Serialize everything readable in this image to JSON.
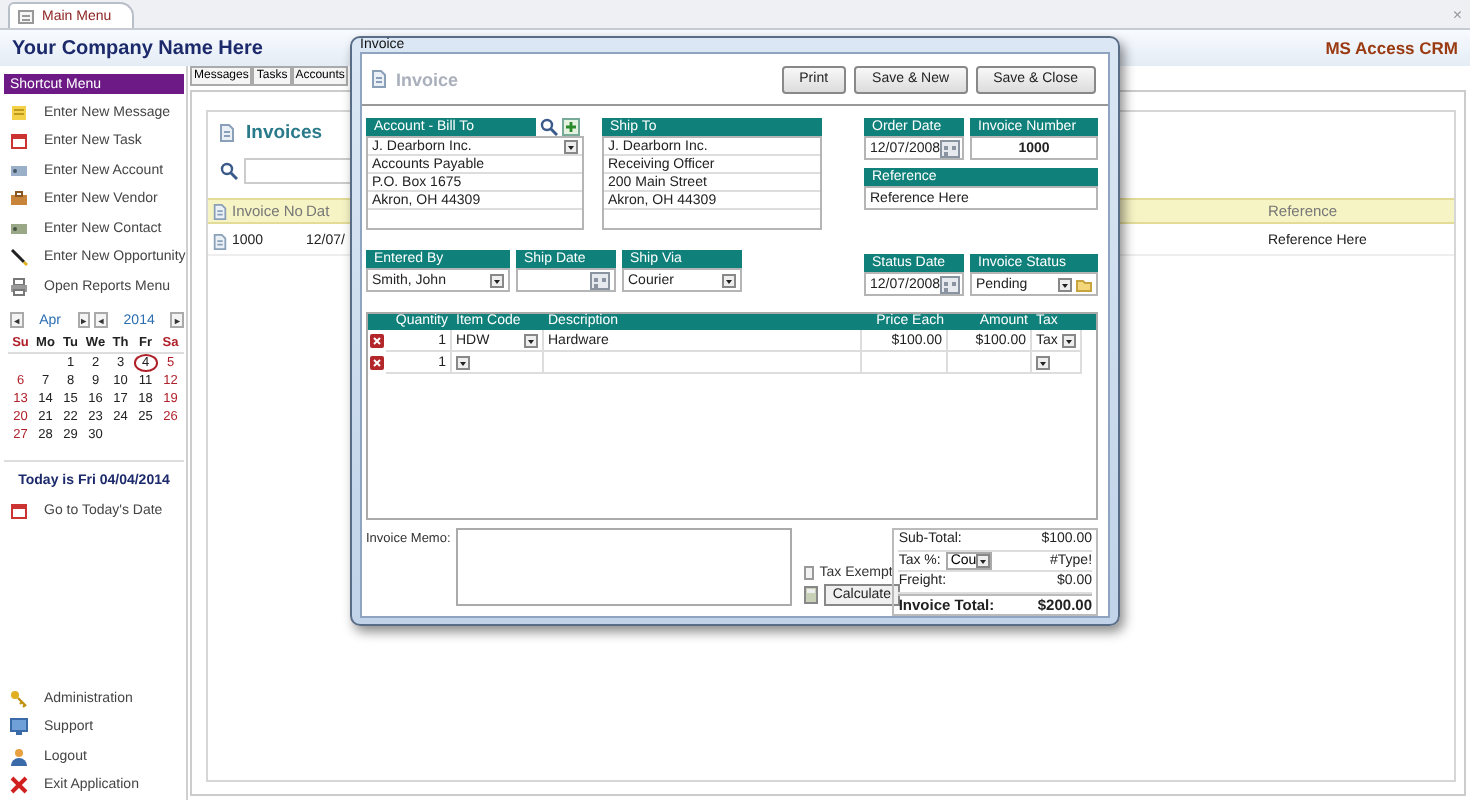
{
  "app_tab": {
    "label": "Main Menu",
    "close": "×"
  },
  "header": {
    "company": "Your Company Name Here",
    "product": "MS Access CRM"
  },
  "sidebar": {
    "title": "Shortcut Menu",
    "items": [
      {
        "label": "Enter New Message"
      },
      {
        "label": "Enter New Task"
      },
      {
        "label": "Enter New Account"
      },
      {
        "label": "Enter New Vendor"
      },
      {
        "label": "Enter New Contact"
      },
      {
        "label": "Enter New Opportunity"
      },
      {
        "label": "Open Reports Menu"
      }
    ],
    "calendar": {
      "month_prev": "◄",
      "month": "Apr",
      "month_next": "►",
      "year_prev": "◄",
      "year": "2014",
      "year_next": "►",
      "weekdays": [
        "Su",
        "Mo",
        "Tu",
        "We",
        "Th",
        "Fr",
        "Sa"
      ],
      "weeks": [
        [
          {
            "day": "1",
            "selected": false
          },
          {
            "day": "2",
            "selected": false
          },
          {
            "day": "3",
            "selected": false
          },
          {
            "day": "4",
            "selected": true
          },
          {
            "day": "5",
            "selected": false
          }
        ],
        [
          {
            "day": "6",
            "selected": false
          },
          {
            "day": "7",
            "selected": false
          },
          {
            "day": "8",
            "selected": false
          },
          {
            "day": "9",
            "selected": false
          },
          {
            "day": "10",
            "selected": false
          },
          {
            "day": "11",
            "selected": false
          },
          {
            "day": "12",
            "selected": false
          }
        ],
        [
          {
            "day": "13",
            "selected": false
          },
          {
            "day": "14",
            "selected": false
          },
          {
            "day": "15",
            "selected": false
          },
          {
            "day": "16",
            "selected": false
          },
          {
            "day": "17",
            "selected": false
          },
          {
            "day": "18",
            "selected": false
          },
          {
            "day": "19",
            "selected": false
          }
        ],
        [
          {
            "day": "20",
            "selected": false
          },
          {
            "day": "21",
            "selected": false
          },
          {
            "day": "22",
            "selected": false
          },
          {
            "day": "23",
            "selected": false
          },
          {
            "day": "24",
            "selected": false
          },
          {
            "day": "25",
            "selected": false
          },
          {
            "day": "26",
            "selected": false
          }
        ],
        [
          {
            "day": "27",
            "selected": false
          },
          {
            "day": "28",
            "selected": false
          },
          {
            "day": "29",
            "selected": false
          },
          {
            "day": "30",
            "selected": false
          }
        ]
      ]
    },
    "today": "Today is Fri 04/04/2014",
    "goto": "Go to Today's Date",
    "footer_items": [
      {
        "label": "Administration"
      },
      {
        "label": "Support"
      },
      {
        "label": "Logout"
      },
      {
        "label": "Exit Application"
      }
    ]
  },
  "tabs": [
    {
      "label": "Messages"
    },
    {
      "label": "Tasks"
    },
    {
      "label": "Accounts"
    }
  ],
  "invoices": {
    "title": "Invoices",
    "columns": [
      "Invoice No",
      "Dat",
      "Reference"
    ],
    "rows": [
      [
        "1000",
        "12/07/",
        "Reference Here"
      ]
    ]
  },
  "dialog": {
    "title": "Invoice",
    "heading": "Invoice",
    "buttons": [
      "Print",
      "Save & New",
      "Save & Close"
    ],
    "bill_to": {
      "label": "Account - Bill To",
      "lines": [
        "J. Dearborn Inc.",
        "Accounts Payable",
        "P.O. Box 1675",
        "Akron, OH  44309"
      ]
    },
    "ship_to": {
      "label": "Ship To",
      "lines": [
        "J. Dearborn Inc.",
        "Receiving Officer",
        "200 Main Street",
        "Akron, OH  44309"
      ]
    },
    "order_date": {
      "label": "Order Date",
      "value": "12/07/2008"
    },
    "invoice_number": {
      "label": "Invoice Number",
      "value": "1000"
    },
    "reference": {
      "label": "Reference",
      "value": "Reference Here"
    },
    "entered_by": {
      "label": "Entered By",
      "value": "Smith, John"
    },
    "ship_date": {
      "label": "Ship Date"
    },
    "ship_via": {
      "label": "Ship Via",
      "value": "Courier"
    },
    "status_date": {
      "label": "Status Date",
      "value": "12/07/2008"
    },
    "invoice_status": {
      "label": "Invoice Status",
      "value": "Pending"
    },
    "line_items": {
      "columns": [
        "Quantity",
        "Item Code",
        "Description",
        "Price Each",
        "Amount",
        "Tax"
      ],
      "rows": [
        {
          "quantity": "1",
          "item_code": "HDW",
          "description": "Hardware",
          "price_each": "$100.00",
          "amount": "$100.00",
          "tax": "Tax"
        },
        {
          "quantity": "1"
        }
      ]
    },
    "memo": {
      "label": "Invoice Memo:"
    },
    "tax_exempt": {
      "label": "Tax Exempt",
      "checked": false
    },
    "calculate": "Calculate",
    "totals": [
      {
        "kind": "plain",
        "label": "Sub-Total:",
        "value": "$100.00"
      },
      {
        "kind": "select",
        "label": "Tax %:",
        "select": "Cou",
        "value": "#Type!"
      },
      {
        "kind": "plain",
        "label": "Freight:",
        "value": "$0.00"
      },
      {
        "kind": "total",
        "label": "Invoice Total:",
        "value": "$200.00"
      }
    ]
  }
}
